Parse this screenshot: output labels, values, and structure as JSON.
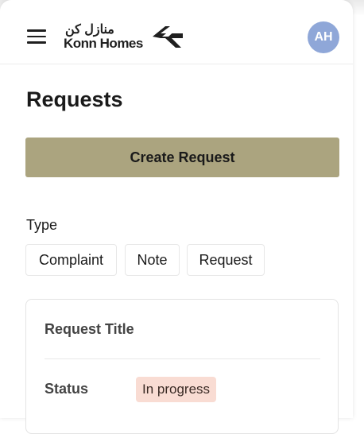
{
  "header": {
    "logo_arabic": "منازل كن",
    "logo_latin": "Konn Homes",
    "avatar_initials": "AH"
  },
  "page": {
    "title": "Requests",
    "create_button": "Create Request"
  },
  "filter": {
    "label": "Type",
    "options": [
      "Complaint",
      "Note",
      "Request"
    ]
  },
  "card": {
    "title": "Request Title",
    "status_label": "Status",
    "status_value": "In progress"
  },
  "icons": {
    "menu": "hamburger-menu-icon",
    "logo": "konn-homes-logo-arrow-icon"
  },
  "colors": {
    "accent": "#aba47f",
    "avatar": "#8fa7d8",
    "status_badge": "#f9dcd3"
  }
}
